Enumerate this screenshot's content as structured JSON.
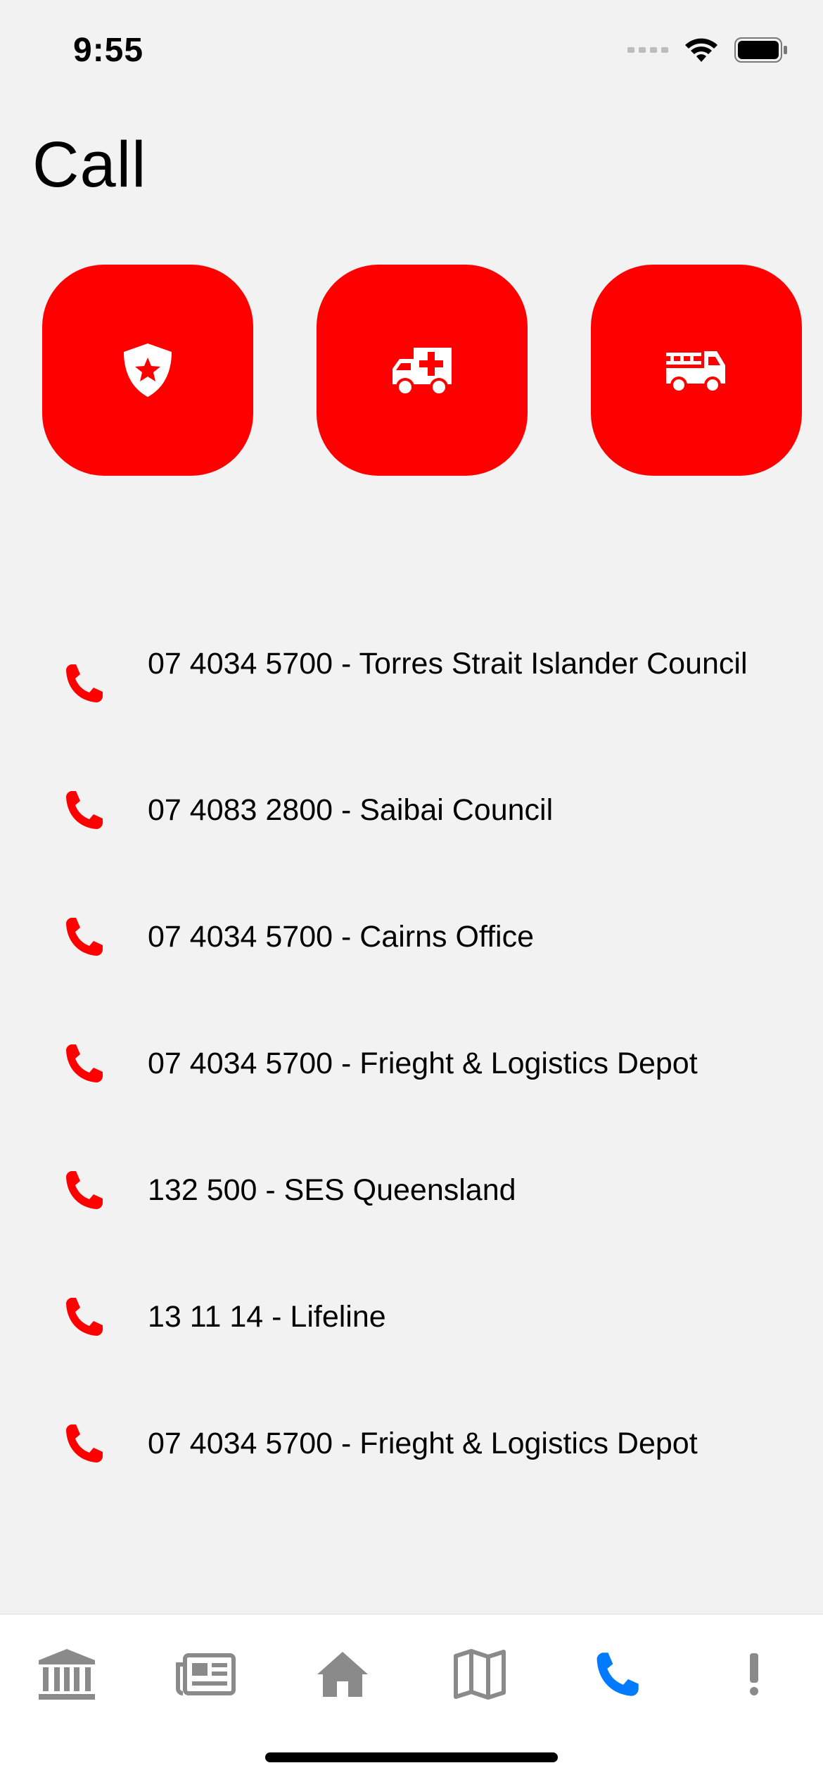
{
  "status_bar": {
    "time": "9:55",
    "icons": [
      "signal-dots-icon",
      "wifi-icon",
      "battery-icon"
    ]
  },
  "page": {
    "title": "Call"
  },
  "emergency_buttons": [
    {
      "name": "police",
      "icon": "police-shield-icon"
    },
    {
      "name": "ambulance",
      "icon": "ambulance-icon"
    },
    {
      "name": "fire",
      "icon": "fire-truck-icon"
    }
  ],
  "contacts": [
    {
      "label": "07 4034 5700 - Torres Strait Islander Council"
    },
    {
      "label": "07 4083 2800 - Saibai Council"
    },
    {
      "label": "07 4034 5700 - Cairns Office"
    },
    {
      "label": "07 4034 5700 - Frieght & Logistics Depot"
    },
    {
      "label": "132 500 - SES Queensland"
    },
    {
      "label": "13 11 14 - Lifeline"
    },
    {
      "label": "07 4034 5700 - Frieght & Logistics Depot"
    }
  ],
  "tabs": [
    {
      "icon": "government-building-icon",
      "active": false
    },
    {
      "icon": "newspaper-icon",
      "active": false
    },
    {
      "icon": "home-icon",
      "active": false
    },
    {
      "icon": "map-icon",
      "active": false
    },
    {
      "icon": "phone-icon",
      "active": true
    },
    {
      "icon": "exclamation-icon",
      "active": false
    }
  ],
  "colors": {
    "accent_red": "#ff0000",
    "active_tab_blue": "#007aff",
    "inactive_tab_gray": "#8a8a8a",
    "background": "#f2f2f2"
  }
}
